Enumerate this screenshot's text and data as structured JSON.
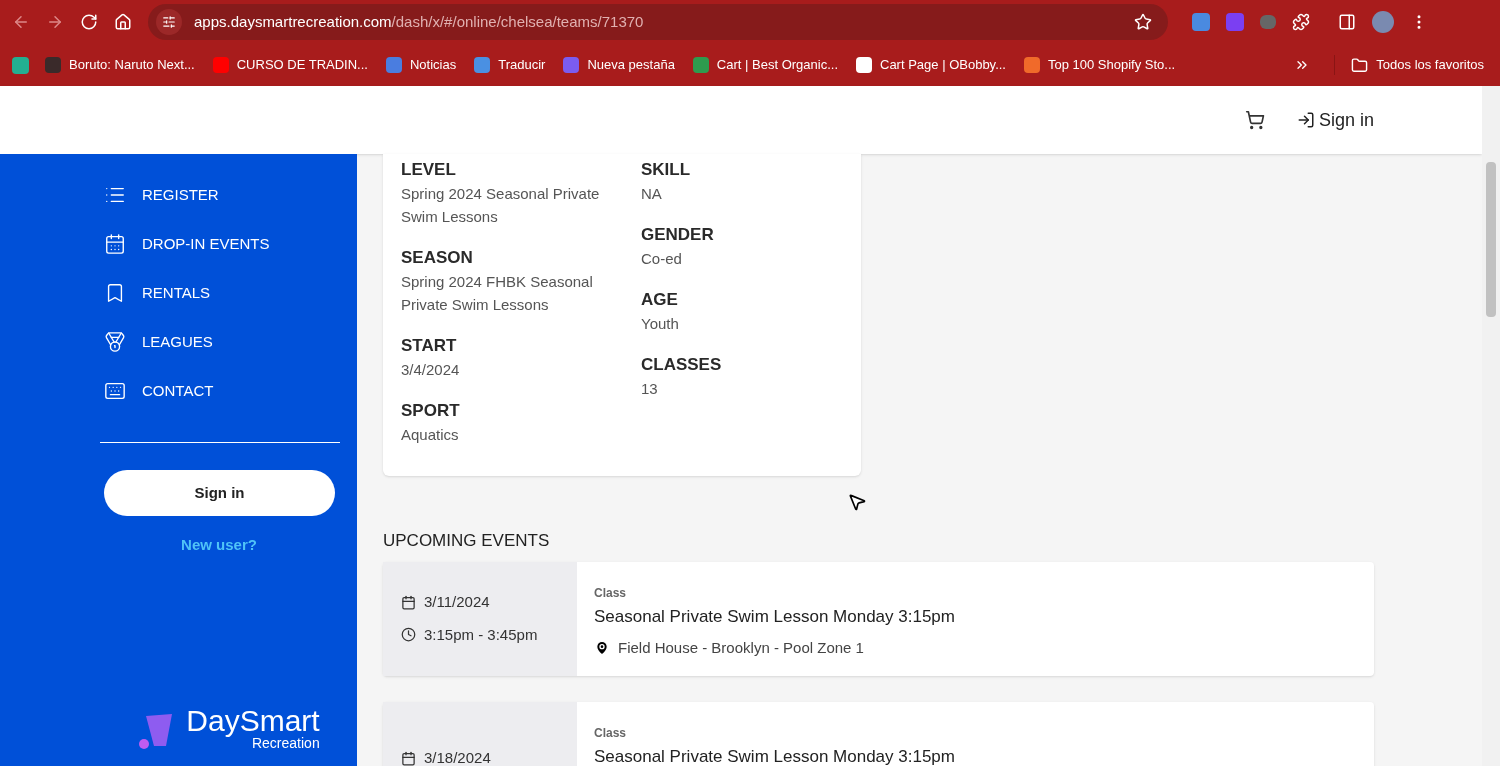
{
  "browser": {
    "url_host": "apps.daysmartrecreation.com",
    "url_path": "/dash/x/#/online/chelsea/teams/71370",
    "bookmarks": [
      {
        "label": "Boruto: Naruto Next..."
      },
      {
        "label": "CURSO DE TRADIN..."
      },
      {
        "label": "Noticias"
      },
      {
        "label": "Traducir"
      },
      {
        "label": "Nueva pestaña"
      },
      {
        "label": "Cart | Best Organic..."
      },
      {
        "label": "Cart Page | OBobby..."
      },
      {
        "label": "Top 100 Shopify Sto..."
      }
    ],
    "all_bookmarks": "Todos los favoritos"
  },
  "header": {
    "sign_in": "Sign in"
  },
  "sidebar": {
    "items": [
      {
        "label": "REGISTER"
      },
      {
        "label": "DROP-IN EVENTS"
      },
      {
        "label": "RENTALS"
      },
      {
        "label": "LEAGUES"
      },
      {
        "label": "CONTACT"
      }
    ],
    "sign_in_button": "Sign in",
    "new_user_link": "New user?",
    "logo_name": "DaySmart",
    "logo_sub": "Recreation"
  },
  "details": {
    "left": [
      {
        "label": "LEVEL",
        "value": "Spring 2024 Seasonal Private Swim Lessons"
      },
      {
        "label": "SEASON",
        "value": "Spring 2024 FHBK Seasonal Private Swim Lessons"
      },
      {
        "label": "START",
        "value": "3/4/2024"
      },
      {
        "label": "SPORT",
        "value": "Aquatics"
      }
    ],
    "right": [
      {
        "label": "SKILL",
        "value": "NA"
      },
      {
        "label": "GENDER",
        "value": "Co-ed"
      },
      {
        "label": "AGE",
        "value": "Youth"
      },
      {
        "label": "CLASSES",
        "value": "13"
      }
    ]
  },
  "upcoming": {
    "title": "UPCOMING EVENTS",
    "events": [
      {
        "date": "3/11/2024",
        "time": "3:15pm - 3:45pm",
        "type": "Class",
        "title": "Seasonal Private Swim Lesson Monday 3:15pm",
        "location": "Field House - Brooklyn - Pool Zone 1"
      },
      {
        "date": "3/18/2024",
        "type": "Class",
        "title": "Seasonal Private Swim Lesson Monday 3:15pm"
      }
    ]
  }
}
